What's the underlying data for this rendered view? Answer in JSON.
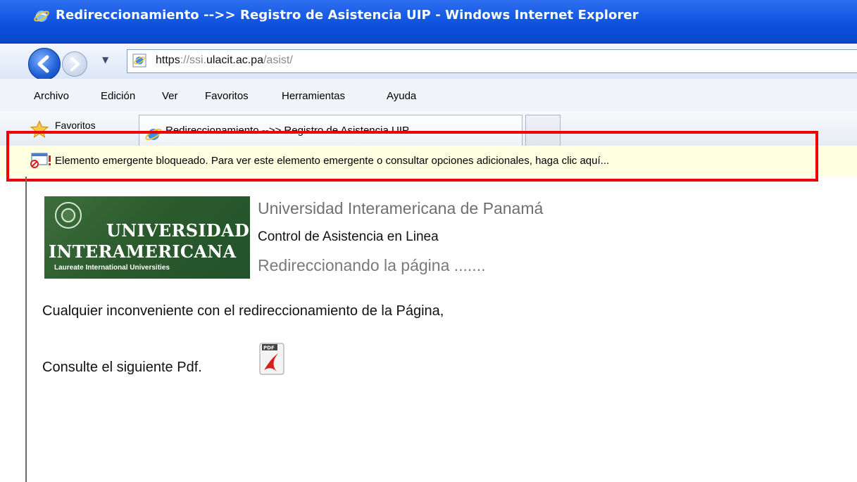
{
  "window": {
    "title": "Redireccionamiento -->> Registro de Asistencia UIP - Windows Internet Explorer"
  },
  "address_bar": {
    "scheme": "https://",
    "host_prefix": "ssi.",
    "host_main": "ulacit.ac.pa",
    "path": "/asist/"
  },
  "menu": [
    "Archivo",
    "Edición",
    "Ver",
    "Favoritos",
    "Herramientas",
    "Ayuda"
  ],
  "favorites_bar": {
    "label": "Favoritos",
    "tab_title": "Redireccionamiento -->> Registro de Asistencia UIP"
  },
  "info_bar": {
    "message": "Elemento emergente bloqueado. Para ver este elemento emergente o consultar opciones adicionales, haga clic aquí..."
  },
  "page": {
    "logo": {
      "line1": "UNIVERSIDAD",
      "line2": "INTERAMERICANA",
      "line3": "Laureate International Universities"
    },
    "university_name": "Universidad Interamericana de Panamá",
    "subtitle": "Control de Asistencia en Linea",
    "redirect_text": "Redireccionando la página .......",
    "issue_text": "Cualquier inconveniente con el redireccionamiento de la Página,",
    "consult_text": "Consulte el siguiente Pdf."
  },
  "colors": {
    "annotation_red": "#ee0000",
    "titlebar_blue": "#0b4fdc",
    "infobar_yellow": "#ffffe1",
    "logo_green": "#2a5a2c"
  }
}
